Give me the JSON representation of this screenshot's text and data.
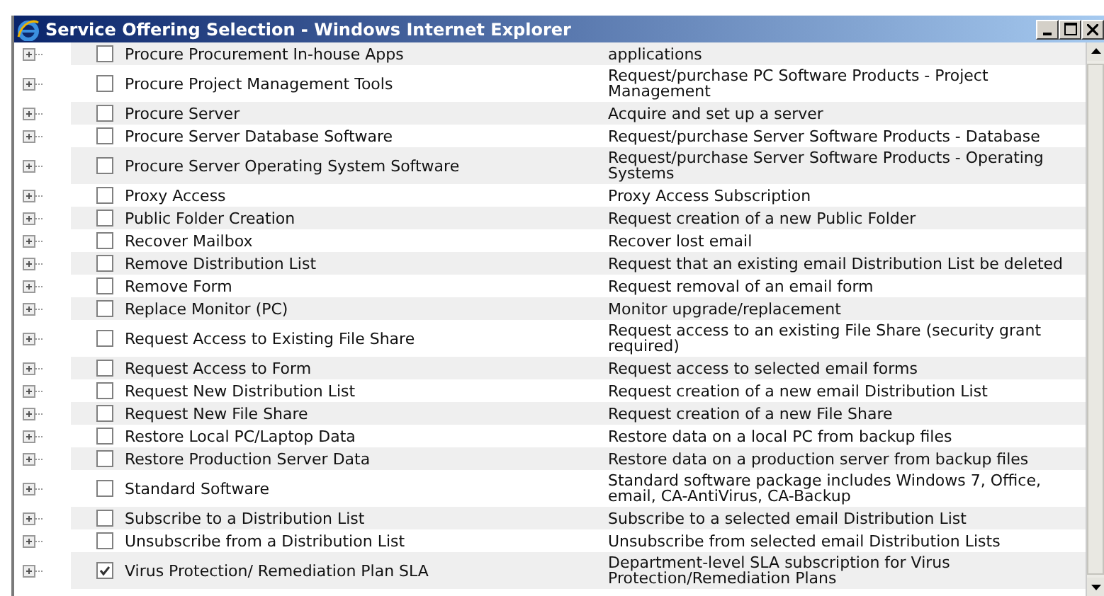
{
  "window": {
    "title": "Service Offering Selection - Windows Internet Explorer"
  },
  "rows": [
    {
      "name": "Procure Procurement In-house Apps",
      "description": "applications",
      "checked": false
    },
    {
      "name": "Procure Project Management Tools",
      "description": "Request/purchase PC Software Products - Project Management",
      "checked": false
    },
    {
      "name": "Procure Server",
      "description": "Acquire and set up a server",
      "checked": false
    },
    {
      "name": "Procure Server Database Software",
      "description": "Request/purchase Server Software Products - Database",
      "checked": false
    },
    {
      "name": "Procure Server Operating System Software",
      "description": "Request/purchase Server Software Products - Operating Systems",
      "checked": false
    },
    {
      "name": "Proxy Access",
      "description": "Proxy Access Subscription",
      "checked": false
    },
    {
      "name": "Public Folder Creation",
      "description": "Request creation of a new Public Folder",
      "checked": false
    },
    {
      "name": "Recover Mailbox",
      "description": "Recover lost email",
      "checked": false
    },
    {
      "name": "Remove Distribution List",
      "description": "Request that an existing email Distribution List be deleted",
      "checked": false
    },
    {
      "name": "Remove Form",
      "description": "Request removal of an email form",
      "checked": false
    },
    {
      "name": "Replace Monitor (PC)",
      "description": "Monitor upgrade/replacement",
      "checked": false
    },
    {
      "name": "Request Access to Existing File Share",
      "description": "Request access to an existing File Share (security grant required)",
      "checked": false
    },
    {
      "name": "Request Access to Form",
      "description": "Request access to selected email forms",
      "checked": false
    },
    {
      "name": "Request New Distribution List",
      "description": "Request creation of a new email Distribution List",
      "checked": false
    },
    {
      "name": "Request New File Share",
      "description": "Request creation of a new File Share",
      "checked": false
    },
    {
      "name": "Restore Local PC/Laptop Data",
      "description": "Restore data on a local PC from backup files",
      "checked": false
    },
    {
      "name": "Restore Production Server Data",
      "description": "Restore data on a production server from backup files",
      "checked": false
    },
    {
      "name": "Standard Software",
      "description": "Standard software package includes Windows 7, Office, email, CA-AntiVirus, CA-Backup",
      "checked": false
    },
    {
      "name": "Subscribe to a Distribution List",
      "description": "Subscribe to a selected email Distribution List",
      "checked": false
    },
    {
      "name": "Unsubscribe from a Distribution List",
      "description": "Unsubscribe from selected email Distribution Lists",
      "checked": false
    },
    {
      "name": "Virus Protection/ Remediation Plan SLA",
      "description": "Department-level SLA subscription for Virus Protection/Remediation Plans",
      "checked": true
    }
  ]
}
